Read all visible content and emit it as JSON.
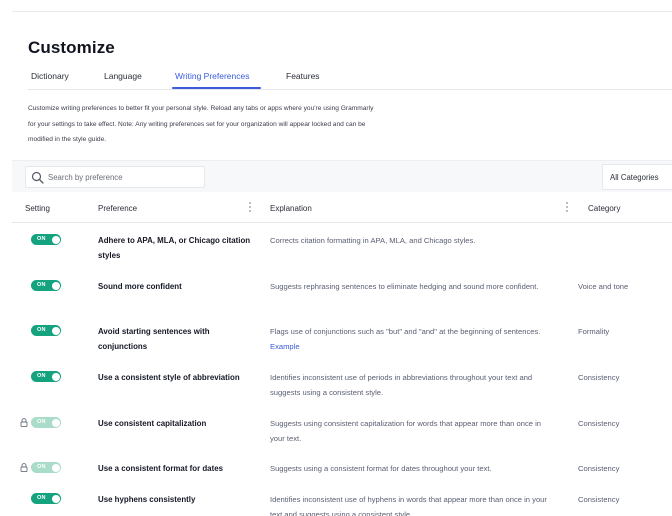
{
  "page": {
    "title": "Customize"
  },
  "tabs": [
    {
      "label": "Dictionary",
      "active": false
    },
    {
      "label": "Language",
      "active": false
    },
    {
      "label": "Writing Preferences",
      "active": true
    },
    {
      "label": "Features",
      "active": false
    }
  ],
  "description": {
    "line1": "Customize writing preferences to better fit your personal style. Reload any tabs or apps where you're using Grammarly",
    "line2": "for your settings to take effect. Note: Any writing preferences set for your organization will appear locked and can be",
    "line3": "modified in the style guide."
  },
  "search": {
    "placeholder": "Search by preference",
    "icon": "search-icon"
  },
  "category_filter": {
    "selected": "All Categories"
  },
  "table": {
    "headers": {
      "setting": "Setting",
      "preference": "Preference",
      "explanation": "Explanation",
      "category": "Category"
    },
    "toggle_on_label": "ON",
    "rows": [
      {
        "state": "ON",
        "locked": false,
        "preference": "Adhere to APA, MLA, or Chicago citation styles",
        "explanation": "Corrects citation formatting in APA, MLA, and Chicago styles.",
        "link": "",
        "category": ""
      },
      {
        "state": "ON",
        "locked": false,
        "preference": "Sound more confident",
        "explanation": "Suggests rephrasing sentences to eliminate hedging and sound more confident.",
        "link": "",
        "category": "Voice and tone"
      },
      {
        "state": "ON",
        "locked": false,
        "preference": "Avoid starting sentences with conjunctions",
        "explanation": "Flags use of conjunctions such as \"but\" and \"and\" at the beginning of sentences.",
        "link": "Example",
        "category": "Formality"
      },
      {
        "state": "ON",
        "locked": false,
        "preference": "Use a consistent style of abbreviation",
        "explanation": "Identifies inconsistent use of periods in abbreviations throughout your text and suggests using a consistent style.",
        "link": "",
        "category": "Consistency"
      },
      {
        "state": "ON",
        "locked": true,
        "preference": "Use consistent capitalization",
        "explanation": "Suggests using consistent capitalization for words that appear more than once in your text.",
        "link": "",
        "category": "Consistency"
      },
      {
        "state": "ON",
        "locked": true,
        "preference": "Use a consistent format for dates",
        "explanation": "Suggests using a consistent format for dates throughout your text.",
        "link": "",
        "category": "Consistency"
      },
      {
        "state": "ON",
        "locked": false,
        "preference": "Use hyphens consistently",
        "explanation": "Identifies inconsistent use of hyphens in words that appear more than once in your text and suggests using a consistent style.",
        "link": "",
        "category": "Consistency"
      }
    ]
  },
  "colors": {
    "accent": "#3b5bdb",
    "toggle_on": "#15a37f",
    "toggle_locked": "#a9dcc9"
  }
}
